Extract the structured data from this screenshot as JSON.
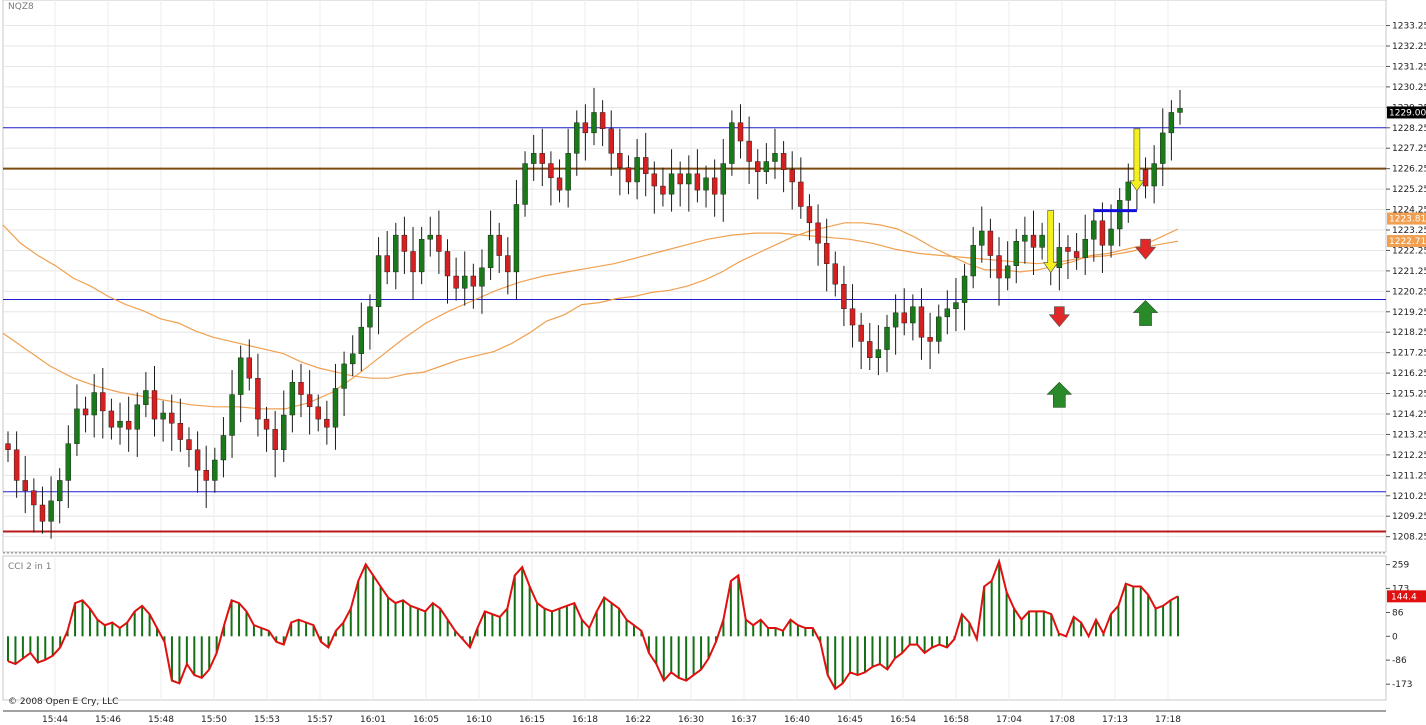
{
  "symbol": "NQZ8",
  "indicator_title": "CCI 2 in 1",
  "copyright": "© 2008 Open E Cry, LLC",
  "colors": {
    "up": "#1a7a1a",
    "down": "#d42020",
    "wick": "#1a1a1a",
    "ma": "#f0a050",
    "blue_line": "#2020d0",
    "brown_line": "#7a4a10",
    "red_line": "#b81818",
    "cci_bar": "#157015",
    "cci_line": "#e01010",
    "yellow_arrow": "#f4f020",
    "green_arrow": "#2a8a2a",
    "red_arrow": "#e02828",
    "short_line": "#1010d8"
  },
  "chart_data": {
    "type": "candlestick",
    "ylim": [
      1207.5,
      1234.5
    ],
    "y_ticks": [
      "1233.25",
      "1232.25",
      "1231.25",
      "1230.25",
      "1229.25",
      "1228.25",
      "1227.25",
      "1226.25",
      "1225.25",
      "1224.25",
      "1223.25",
      "1222.25",
      "1221.25",
      "1220.25",
      "1219.25",
      "1218.25",
      "1217.25",
      "1216.25",
      "1215.25",
      "1214.25",
      "1213.25",
      "1212.25",
      "1211.25",
      "1210.25",
      "1209.25",
      "1208.25"
    ],
    "x_labels": [
      "15:44",
      "15:46",
      "15:48",
      "15:50",
      "15:53",
      "15:57",
      "16:01",
      "16:05",
      "16:10",
      "16:15",
      "16:18",
      "16:22",
      "16:30",
      "16:37",
      "16:40",
      "16:45",
      "16:54",
      "16:58",
      "17:04",
      "17:08",
      "17:13",
      "17:18"
    ],
    "price_tags": [
      {
        "label": "1229.00",
        "value": 1229.0,
        "color": "#000000"
      },
      {
        "label": "1223.81",
        "value": 1223.81,
        "color": "#f0a050"
      },
      {
        "label": "1222.71",
        "value": 1222.71,
        "color": "#f0a050"
      }
    ],
    "horizontal_lines": [
      {
        "value": 1228.25,
        "color": "blue"
      },
      {
        "value": 1226.25,
        "color": "brown"
      },
      {
        "value": 1219.85,
        "color": "blue"
      },
      {
        "value": 1210.45,
        "color": "blue"
      },
      {
        "value": 1208.5,
        "color": "red"
      }
    ],
    "close": [
      1212.5,
      1211.0,
      1210.5,
      1209.8,
      1209.0,
      1210.0,
      1211.0,
      1212.8,
      1214.5,
      1214.2,
      1215.3,
      1214.4,
      1213.6,
      1213.9,
      1213.5,
      1214.7,
      1215.4,
      1214.0,
      1214.3,
      1213.8,
      1213.0,
      1212.5,
      1211.5,
      1211.0,
      1212.0,
      1213.2,
      1215.2,
      1217.0,
      1216.0,
      1214.0,
      1213.5,
      1212.5,
      1214.2,
      1215.8,
      1215.2,
      1214.6,
      1214.0,
      1213.6,
      1215.5,
      1216.7,
      1217.2,
      1218.5,
      1219.5,
      1222.0,
      1221.2,
      1223.0,
      1222.2,
      1221.2,
      1222.8,
      1223.0,
      1222.2,
      1221.0,
      1220.4,
      1221.0,
      1220.5,
      1221.4,
      1223.0,
      1222.0,
      1221.2,
      1224.5,
      1226.5,
      1227.0,
      1226.5,
      1225.8,
      1225.2,
      1227.0,
      1228.5,
      1228.0,
      1229.0,
      1228.2,
      1227.0,
      1226.3,
      1225.6,
      1226.8,
      1226.0,
      1225.4,
      1225.0,
      1226.0,
      1225.5,
      1226.0,
      1225.2,
      1225.8,
      1225.0,
      1226.5,
      1228.5,
      1227.6,
      1226.6,
      1226.1,
      1226.6,
      1227.0,
      1226.2,
      1225.6,
      1224.4,
      1223.6,
      1222.6,
      1221.6,
      1220.6,
      1219.4,
      1218.6,
      1217.8,
      1217.0,
      1217.4,
      1218.5,
      1219.2,
      1218.7,
      1219.5,
      1218.0,
      1217.8,
      1219.0,
      1219.4,
      1219.7,
      1221.0,
      1222.5,
      1223.2,
      1222.0,
      1220.9,
      1221.5,
      1222.7,
      1223.0,
      1222.4,
      1223.0,
      1221.4,
      1222.4,
      1222.2,
      1221.9,
      1222.8,
      1223.7,
      1222.5,
      1223.3,
      1224.7,
      1225.6,
      1226.2,
      1225.4,
      1226.5,
      1228.0,
      1229.0,
      1229.2
    ],
    "open": [
      1212.8,
      1212.5,
      1211.0,
      1210.5,
      1209.8,
      1209.0,
      1210.0,
      1211.0,
      1212.8,
      1214.5,
      1214.2,
      1215.3,
      1214.4,
      1213.6,
      1213.9,
      1213.5,
      1214.7,
      1215.4,
      1214.0,
      1214.3,
      1213.8,
      1213.0,
      1212.5,
      1211.5,
      1211.0,
      1212.0,
      1213.2,
      1215.2,
      1217.0,
      1216.0,
      1214.0,
      1213.5,
      1212.5,
      1214.2,
      1215.8,
      1215.2,
      1214.6,
      1214.0,
      1213.6,
      1215.5,
      1216.7,
      1217.2,
      1218.5,
      1219.5,
      1222.0,
      1221.2,
      1223.0,
      1222.2,
      1221.2,
      1222.8,
      1223.0,
      1222.2,
      1221.0,
      1220.4,
      1221.0,
      1220.5,
      1221.4,
      1223.0,
      1222.0,
      1221.2,
      1224.5,
      1226.5,
      1227.0,
      1226.5,
      1225.8,
      1225.2,
      1227.0,
      1228.5,
      1228.0,
      1229.0,
      1228.2,
      1227.0,
      1226.3,
      1225.6,
      1226.8,
      1226.0,
      1225.4,
      1225.0,
      1226.0,
      1225.5,
      1226.0,
      1225.2,
      1225.8,
      1225.0,
      1226.5,
      1228.5,
      1227.6,
      1226.6,
      1226.1,
      1226.6,
      1227.0,
      1226.2,
      1225.6,
      1224.4,
      1223.6,
      1222.6,
      1221.6,
      1220.6,
      1219.4,
      1218.6,
      1217.8,
      1217.0,
      1217.4,
      1218.5,
      1219.2,
      1218.7,
      1219.5,
      1218.0,
      1217.8,
      1219.0,
      1219.4,
      1219.7,
      1221.0,
      1222.5,
      1223.2,
      1222.0,
      1220.9,
      1221.5,
      1222.7,
      1223.0,
      1222.4,
      1223.0,
      1221.4,
      1222.4,
      1222.2,
      1221.9,
      1222.8,
      1223.7,
      1222.5,
      1223.3,
      1224.7,
      1225.6,
      1226.2,
      1225.4,
      1226.5,
      1228.0,
      1229.0
    ],
    "moving_averages": [
      {
        "values": [
          1223.5,
          1222.6,
          1222.0,
          1221.5,
          1220.9,
          1220.5,
          1220.0,
          1219.6,
          1219.3,
          1218.9,
          1218.7,
          1218.3,
          1218.0,
          1217.8,
          1217.6,
          1217.4,
          1217.2,
          1216.8,
          1216.5,
          1216.3,
          1216.1,
          1216.0,
          1216.0,
          1216.2,
          1216.3,
          1216.6,
          1216.9,
          1217.1,
          1217.3,
          1217.7,
          1218.2,
          1218.8,
          1219.1,
          1219.6,
          1219.7,
          1219.9,
          1220.0,
          1220.2,
          1220.3,
          1220.5,
          1220.8,
          1221.2,
          1221.7,
          1222.1,
          1222.5,
          1222.9,
          1223.2,
          1223.4,
          1223.6,
          1223.6,
          1223.5,
          1223.3,
          1222.9,
          1222.4,
          1222.0,
          1221.6,
          1221.3,
          1221.3,
          1221.2,
          1221.3,
          1221.5,
          1221.7,
          1222.0,
          1222.1,
          1222.3,
          1222.5,
          1222.9,
          1223.3
        ],
        "label": "ma_fast"
      },
      {
        "values": [
          1218.2,
          1217.4,
          1216.6,
          1216.0,
          1215.6,
          1215.3,
          1215.1,
          1214.9,
          1214.7,
          1214.6,
          1214.6,
          1214.5,
          1214.5,
          1214.8,
          1215.3,
          1216.1,
          1217.0,
          1217.9,
          1218.7,
          1219.3,
          1219.8,
          1220.3,
          1220.7,
          1221.0,
          1221.2,
          1221.4,
          1221.6,
          1221.9,
          1222.2,
          1222.5,
          1222.8,
          1223.0,
          1223.1,
          1223.1,
          1223.0,
          1222.9,
          1222.8,
          1222.6,
          1222.3,
          1222.1,
          1222.0,
          1221.9,
          1221.8,
          1221.7,
          1221.6,
          1221.7,
          1221.9,
          1222.0,
          1222.2,
          1222.5,
          1222.7
        ],
        "label": "ma_slow"
      }
    ],
    "cci": {
      "ticks": [
        "259",
        "173",
        "86",
        "0",
        "-86",
        "-173"
      ],
      "ylim": [
        -230,
        290
      ],
      "last_label": "144.4",
      "values": [
        -90,
        -100,
        -80,
        -60,
        -95,
        -85,
        -70,
        -40,
        20,
        120,
        130,
        100,
        60,
        40,
        50,
        30,
        50,
        90,
        110,
        80,
        30,
        -20,
        -160,
        -170,
        -100,
        -140,
        -150,
        -120,
        -60,
        40,
        130,
        120,
        90,
        40,
        30,
        20,
        -20,
        -30,
        50,
        60,
        50,
        40,
        -20,
        -40,
        20,
        50,
        100,
        200,
        260,
        220,
        180,
        140,
        120,
        130,
        110,
        100,
        90,
        120,
        100,
        60,
        20,
        -10,
        -40,
        30,
        90,
        80,
        70,
        100,
        220,
        250,
        180,
        120,
        100,
        90,
        100,
        110,
        120,
        60,
        30,
        90,
        140,
        120,
        100,
        60,
        40,
        20,
        -60,
        -100,
        -160,
        -130,
        -150,
        -160,
        -140,
        -120,
        -80,
        -20,
        60,
        200,
        220,
        60,
        40,
        60,
        30,
        30,
        20,
        60,
        40,
        30,
        30,
        -20,
        -140,
        -190,
        -170,
        -130,
        -140,
        -130,
        -110,
        -100,
        -120,
        -80,
        -60,
        -30,
        -30,
        -60,
        -40,
        -30,
        -40,
        -10,
        80,
        50,
        -10,
        180,
        200,
        270,
        160,
        100,
        60,
        90,
        90,
        90,
        80,
        10,
        0,
        70,
        50,
        0,
        60,
        10,
        80,
        110,
        190,
        180,
        180,
        150,
        100,
        110,
        130,
        145
      ]
    },
    "markers": [
      {
        "type": "yellow_down",
        "index": 121,
        "value": 1224.2
      },
      {
        "type": "red_down",
        "index": 122,
        "value": 1219.5
      },
      {
        "type": "green_up",
        "index": 122,
        "value": 1215.8
      },
      {
        "type": "yellow_down",
        "index": 131,
        "value": 1228.2
      },
      {
        "type": "red_down",
        "index": 132,
        "value": 1222.8
      },
      {
        "type": "green_up",
        "index": 132,
        "value": 1219.8
      }
    ],
    "short_segment": {
      "value": 1224.2,
      "from_index": 126,
      "to_index": 131
    }
  }
}
